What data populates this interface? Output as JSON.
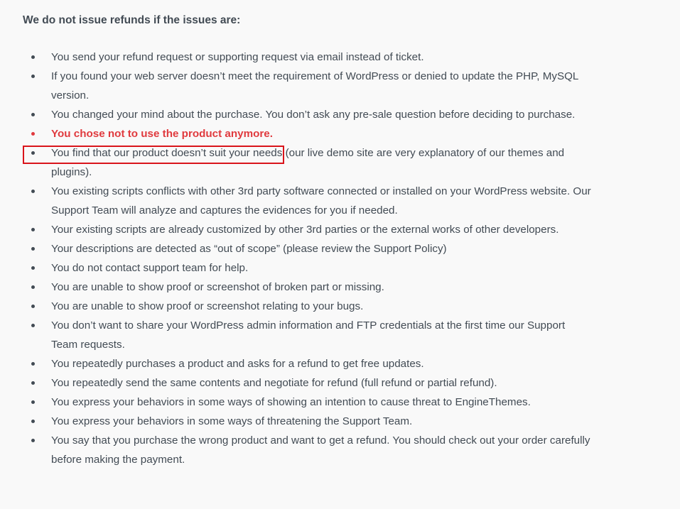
{
  "heading": "We do not issue refunds if the issues are:",
  "annotation_color": "#d9141b",
  "highlight_color": "#e03a3e",
  "items": [
    {
      "text": "You send your refund request or supporting request via email instead of ticket.",
      "highlighted": false
    },
    {
      "text": "If you found your web server doesn’t meet the requirement of WordPress or denied to update the PHP, MySQL version.",
      "highlighted": false
    },
    {
      "text": "You changed your mind about the purchase. You don’t ask any pre-sale question before deciding to purchase.",
      "highlighted": false
    },
    {
      "text": "You chose not to use the product anymore.",
      "highlighted": true
    },
    {
      "text": "You find that our product doesn’t suit your needs (our live demo site are very explanatory of our themes and plugins).",
      "highlighted": false
    },
    {
      "text": "You existing scripts conflicts with other 3rd party software connected or installed on your WordPress website. Our Support Team will analyze and captures the evidences for you if needed.",
      "highlighted": false
    },
    {
      "text": "Your existing scripts are already customized by other 3rd parties or the external works of other developers.",
      "highlighted": false
    },
    {
      "text": "Your descriptions are detected as “out of scope” (please review the Support Policy)",
      "highlighted": false
    },
    {
      "text": "You do not contact support team for help.",
      "highlighted": false
    },
    {
      "text": "You are unable to show proof or screenshot of broken part or missing.",
      "highlighted": false
    },
    {
      "text": "You are unable to show proof or screenshot relating to your bugs.",
      "highlighted": false
    },
    {
      "text": "You don’t want to share your WordPress admin information and FTP credentials at the first time our Support Team requests.",
      "highlighted": false
    },
    {
      "text": "You repeatedly purchases a product and asks for a refund to get free updates.",
      "highlighted": false
    },
    {
      "text": "You repeatedly send the same contents and negotiate for refund (full refund or partial refund).",
      "highlighted": false
    },
    {
      "text": "You express your behaviors in some ways of showing an intention to cause threat to EngineThemes.",
      "highlighted": false
    },
    {
      "text": "You express your behaviors in some ways of threatening the Support Team.",
      "highlighted": false
    },
    {
      "text": "You say that you purchase the wrong product and want to get a refund. You should check out your order carefully before making the payment.",
      "highlighted": false
    }
  ]
}
